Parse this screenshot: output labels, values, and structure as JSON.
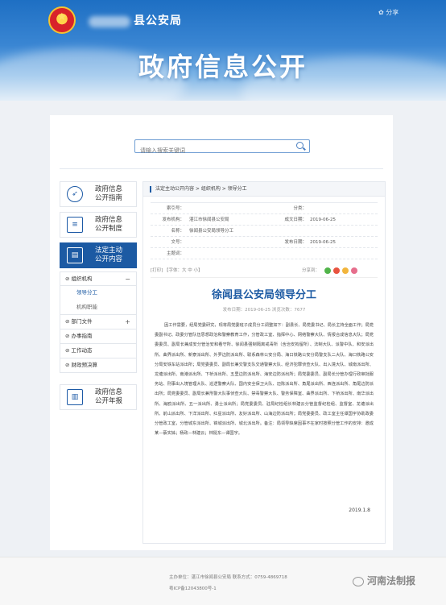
{
  "header": {
    "county_name": "县公安局",
    "share_label": "✿ 分享",
    "hero_title": "政府信息公开"
  },
  "search": {
    "placeholder": "请输入搜索关键词"
  },
  "sidebar": {
    "items": [
      {
        "label_line1": "政府信息",
        "label_line2": "公开指南",
        "icon": "compass-icon"
      },
      {
        "label_line1": "政府信息",
        "label_line2": "公开制度",
        "icon": "document-list-icon"
      },
      {
        "label_line1": "法定主动",
        "label_line2": "公开内容",
        "icon": "file-icon"
      },
      {
        "label_line1": "政府信息",
        "label_line2": "公开年报",
        "icon": "book-icon"
      }
    ],
    "subnav": {
      "org": "组织机构",
      "leader": "领导分工",
      "org_setup": "机构职能",
      "dept_docs": "部门文件",
      "affairs": "办事指南",
      "work": "工作动态",
      "finance": "财政预决算"
    }
  },
  "breadcrumb": {
    "text": "法定主动公开内容 > 组织机构 > 领导分工"
  },
  "meta": {
    "index_no_label": "索引号：",
    "index_no": "",
    "category_label": "分类：",
    "category": "",
    "publisher_label": "发布机构：",
    "publisher": "湛江市徐闻县公安局",
    "created_label": "成文日期：",
    "created": "2019-06-25",
    "name_label": "名称：",
    "name": "徐闻县公安局领导分工",
    "docno_label": "文号：",
    "docno": "",
    "pubdate_label": "发布日期：",
    "pubdate": "2019-06-25",
    "keyword_label": "主题词：",
    "keyword": ""
  },
  "tools": {
    "print": "[打印]",
    "fontsize": "【字体：大  中  小】",
    "share": "分享到："
  },
  "article": {
    "title": "徐闻县公安局领导分工",
    "subtitle": "发布日期：2019-06-25    浏览次数：7677",
    "body": "因工作需要，经局党委研究，现将局党委班子成员分工调整如下：副县长、局党委书记、局长主持全面工作；局党委副书记、政委分管队伍思想政治和警察教育工作，分管政工室、指挥中心、网络警察大队、情报合成信息大队；局党委委员、副局长兼成安分管治安和看守所、徐闻县强制隔离戒毒所（含治安拘留所）、法制大队、派警中队、和安派出所、曲界派出所、新寮派出所、外罗边防派出所、联系森林公安分局、海口铁路公安分局警支队二大队、海口铁路公安分局安铁车站派出所；局党委委员、副局长兼交警支队交通警察大队、经济犯罪侦查大队、出入境大队、城南派出所、龙塘派出所、南港派出所、下桥派出所、五里边防派出所、海安边防派出所；局党委委员、副局长分管办理行政审批服务站、刑事出入境管理大队、巡逻警察大队、国内安全保卫大队、迈陈派出所、角尾派出所、西连派出所、角尾边防派出所；局党委委员、副局长兼刑警大队事侦查大队、禁毒警察大队、警务保障室、曲界派出所、下桥派出所、南华派出所、海鸥派出所、五一派出所、勇士派出所；局党委委员、驻局纪检组长林建云分管监督纪检组、监督室、龙塘派出所、前山派出所、下洋派出所、红星派出所、友好派出所、山海边防派出所；局党委委员、政工室主任谭国宇协助政委分管政工室，分管城东派出所、锦城派出所、城北派出所。备注：局领导缺席因事不在家时按照分管工作的安排：邀成某—蔡实姊；杨政—林建云；林挺东—谭国宇。",
    "date": "2019.1.8"
  },
  "footer": {
    "line1": "主办单位：湛江市徐闻县公安局    联系方式：0759-4869718",
    "line2": "粤ICP备12043800号-1",
    "watermark": "河南法制报"
  },
  "colors": {
    "brand_blue": "#1c5aa3",
    "sky_blue": "#3a86d3"
  }
}
